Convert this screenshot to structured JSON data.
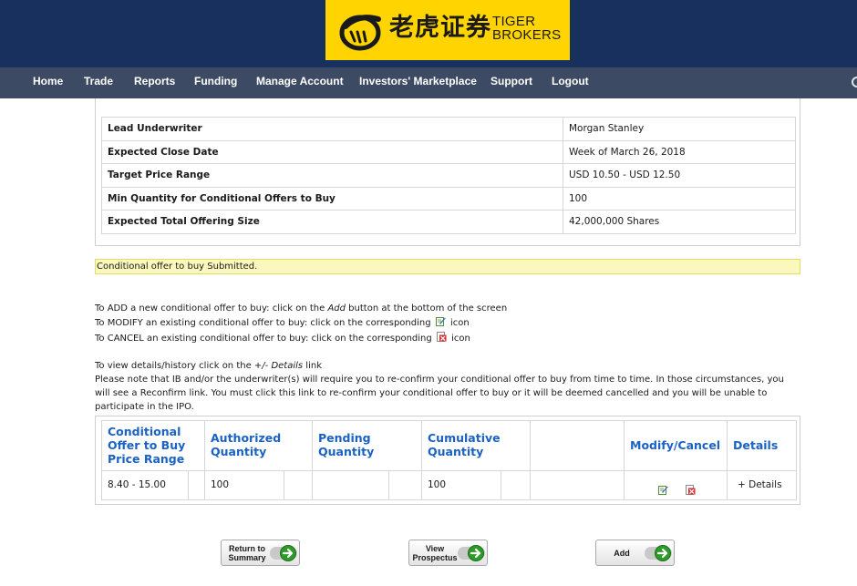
{
  "brand": {
    "cn": "老虎证券",
    "en_line1": "TIGER",
    "en_line2": "BROKERS",
    "colors": {
      "logo_bg": "#ffd400",
      "header_bg": "#17305e",
      "nav_bg": "#3c4a63",
      "link": "#1a62c4"
    }
  },
  "nav": {
    "items": [
      "Home",
      "Trade",
      "Reports",
      "Funding",
      "Manage Account",
      "Investors' Marketplace",
      "Support",
      "Logout"
    ]
  },
  "details": {
    "rows": [
      {
        "label": "Lead Underwriter",
        "value": "Morgan Stanley"
      },
      {
        "label": "Expected Close Date",
        "value": "Week of March 26, 2018"
      },
      {
        "label": "Target Price Range",
        "value": "USD 10.50 - USD 12.50"
      },
      {
        "label": "Min Quantity for Conditional Offers to Buy",
        "value": "100"
      },
      {
        "label": "Expected Total Offering Size",
        "value": "42,000,000 Shares"
      }
    ]
  },
  "status": {
    "message": "Conditional offer to buy Submitted."
  },
  "instructions": {
    "add_pre": "To ADD a new conditional offer to buy: click on the ",
    "add_em": "Add",
    "add_post": " button at the bottom of the screen",
    "modify_pre": "To MODIFY an existing conditional offer to buy: click on the corresponding",
    "modify_post": "icon",
    "cancel_pre": "To CANCEL an existing conditional offer to buy: click on the corresponding",
    "cancel_post": "icon",
    "view_pre": "To view details/history click on the ",
    "view_em": "+/- Details",
    "view_post": " link",
    "note": "Please note that IB and/or the underwriter(s) will require you to re-confirm your conditional offer to buy from time to time. In those circumstances, you will see a Reconfirm link. You must click this link to re-confirm your conditional offer to buy or it will be deemed cancelled and you will be unable to participate in the IPO."
  },
  "offers": {
    "headers": {
      "price_range": [
        "Conditional",
        "Offer to Buy",
        "Price Range"
      ],
      "authorized": [
        "Authorized",
        "Quantity"
      ],
      "pending": [
        "Pending",
        "Quantity"
      ],
      "cumulative": [
        "Cumulative",
        "Quantity"
      ],
      "modify_cancel": "Modify/Cancel",
      "details": "Details"
    },
    "rows": [
      {
        "price_range": "8.40 - 15.00",
        "authorized": "100",
        "pending": "",
        "cumulative": "100",
        "details_link": "+ Details",
        "icons": [
          "edit-icon",
          "cancel-icon"
        ]
      }
    ]
  },
  "buttons": {
    "return": [
      "Return to",
      "Summary"
    ],
    "prospectus": [
      "View",
      "Prospectus"
    ],
    "add": "Add"
  }
}
